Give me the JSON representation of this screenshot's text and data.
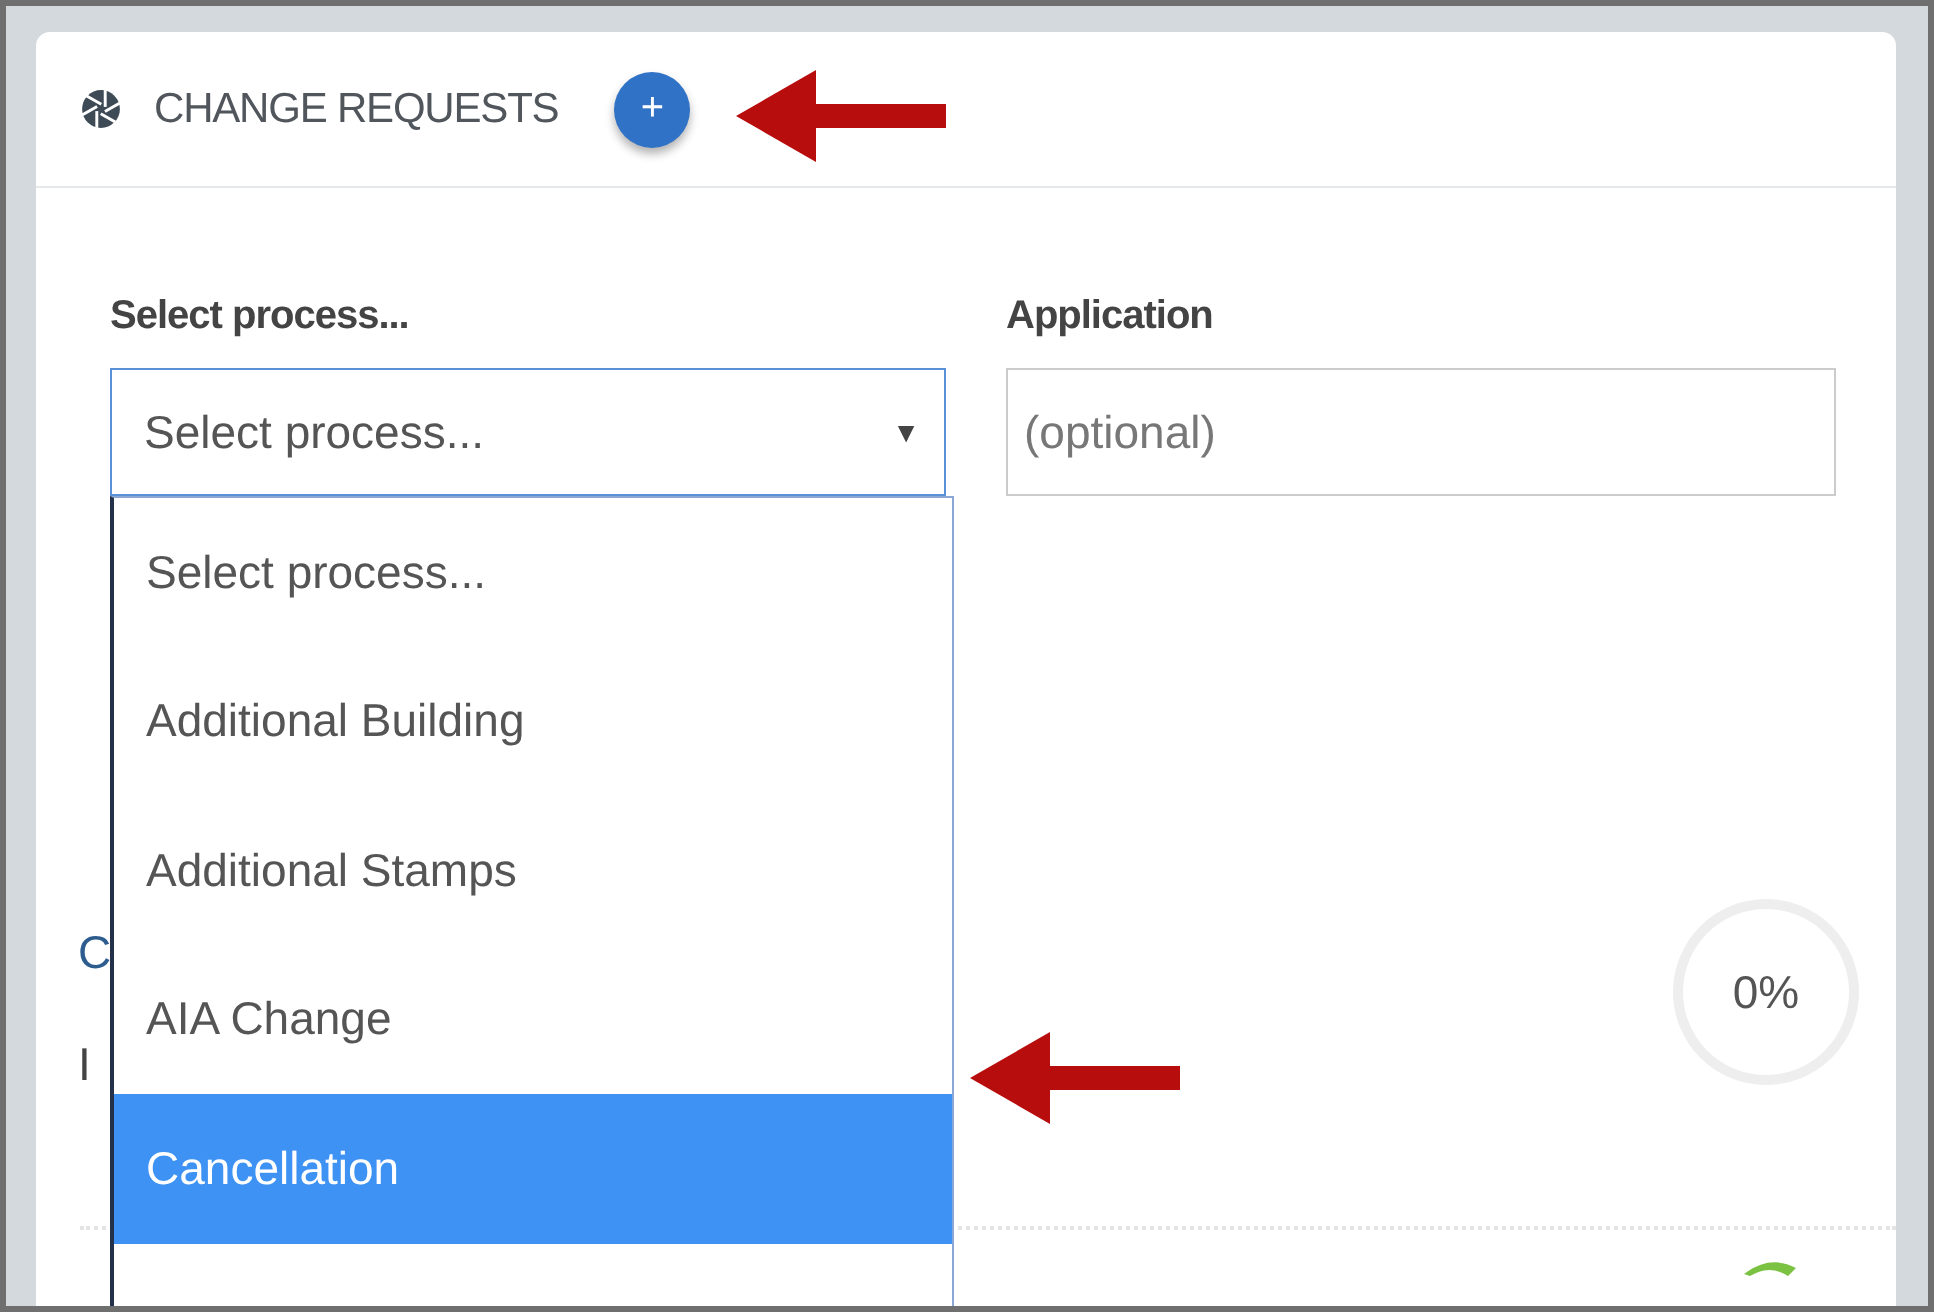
{
  "panel": {
    "title": "CHANGE REQUESTS",
    "add_button": "+"
  },
  "process_field": {
    "label": "Select process...",
    "value": "Select process...",
    "caret": "▼",
    "expanded": true
  },
  "application_field": {
    "label": "Application",
    "placeholder": "(optional)"
  },
  "dropdown": [
    {
      "label": "Select process...",
      "selected": false
    },
    {
      "label": "Additional Building",
      "selected": false
    },
    {
      "label": "Additional Stamps",
      "selected": false
    },
    {
      "label": "AIA Change",
      "selected": false
    },
    {
      "label": "Cancellation",
      "selected": true
    }
  ],
  "hidden_text": [
    "C",
    "I"
  ],
  "progress": {
    "level": 0,
    "reading": "0%"
  }
}
